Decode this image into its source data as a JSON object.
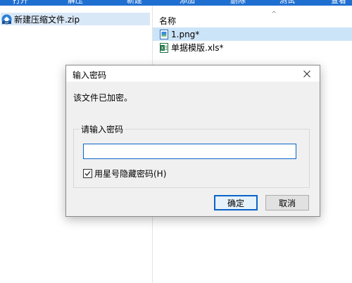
{
  "toolbar": {
    "buttons": [
      "打开",
      "解压",
      "新建",
      "添加",
      "删除",
      "测试",
      "查看"
    ]
  },
  "tree": {
    "archive_name": "新建压缩文件.zip"
  },
  "file_list": {
    "column_name": "名称",
    "files": [
      {
        "name": "1.png*",
        "selected": true
      },
      {
        "name": "单据模版.xls*",
        "selected": false
      }
    ]
  },
  "dialog": {
    "title": "输入密码",
    "message": "该文件已加密。",
    "group_label": "请输入密码",
    "password_value": "",
    "hide_password_label": "用星号隐藏密码(H)",
    "hide_password_checked": true,
    "ok_label": "确定",
    "cancel_label": "取消"
  },
  "colors": {
    "toolbar_bg": "#1f6fd1",
    "selection": "#cce4f7",
    "dialog_bg": "#f0f0f0",
    "accent": "#0a64c8"
  }
}
